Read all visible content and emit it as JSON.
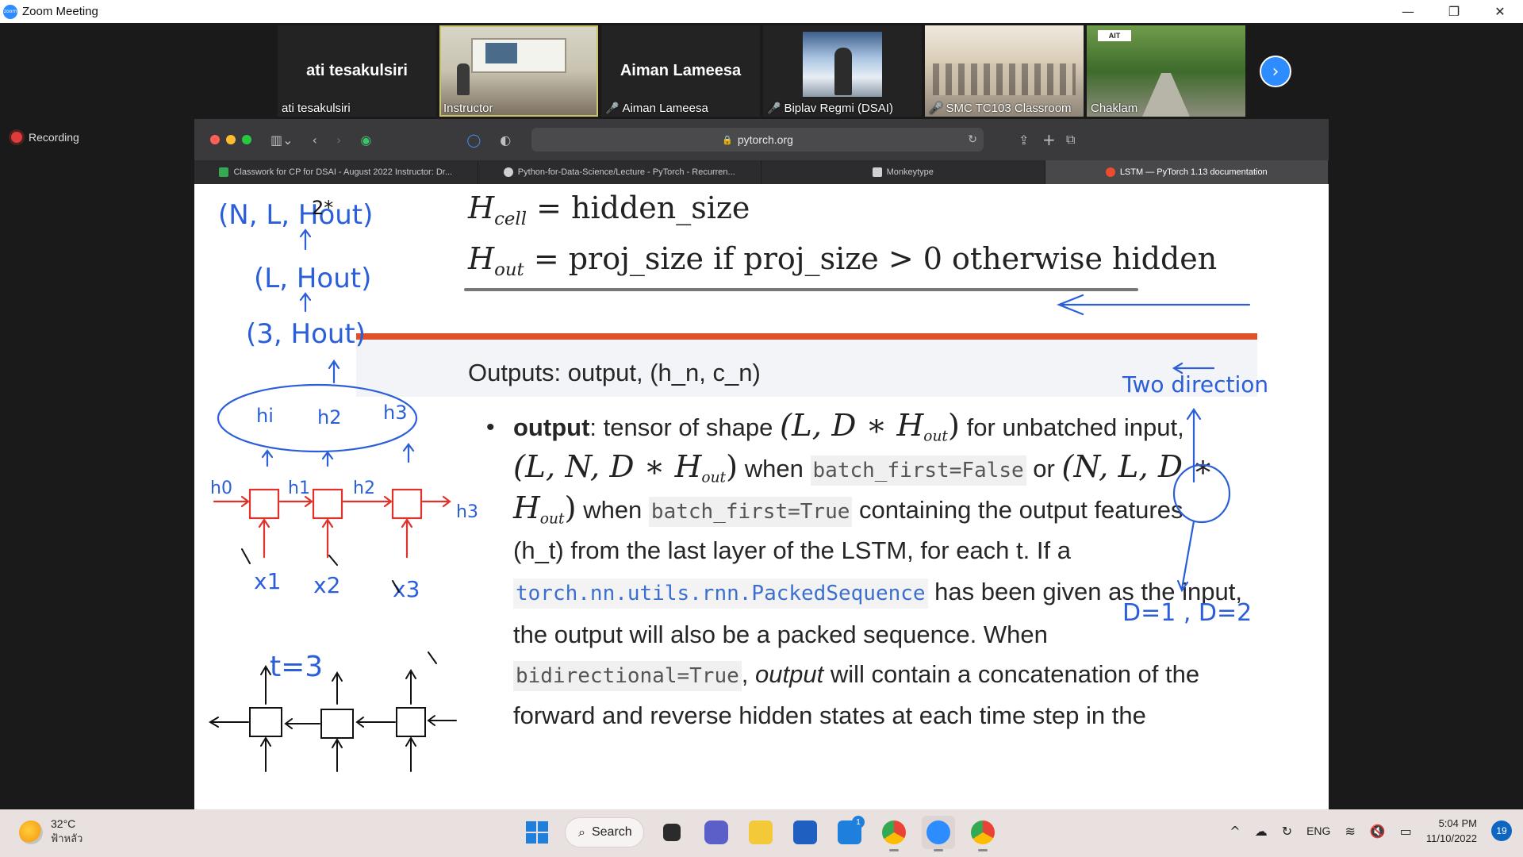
{
  "window": {
    "title": "Zoom Meeting",
    "controls": {
      "minimize": "—",
      "restore": "❐",
      "close": "✕"
    }
  },
  "participants": [
    {
      "big_name": "ati tesakulsiri",
      "name": "ati tesakulsiri",
      "muted": false
    },
    {
      "big_name": "",
      "name": "Instructor",
      "muted": false
    },
    {
      "big_name": "Aiman Lameesa",
      "name": "Aiman Lameesa",
      "muted": true
    },
    {
      "big_name": "",
      "name": "Biplav Regmi (DSAI)",
      "muted": true
    },
    {
      "big_name": "",
      "name": "SMC TC103 Classroom",
      "muted": true
    },
    {
      "big_name": "",
      "name": "Chaklam",
      "muted": false
    }
  ],
  "recording_label": "Recording",
  "tile_logo_text": "AIT",
  "browser": {
    "url": "pytorch.org",
    "tabs": [
      {
        "title": "Classwork for CP for DSAI - August 2022 Instructor: Dr...",
        "color": "#34a853"
      },
      {
        "title": "Python-for-Data-Science/Lecture - PyTorch - Recurren...",
        "color": "#d0d0d0"
      },
      {
        "title": "Monkeytype",
        "color": "#d0d0d0"
      },
      {
        "title": "LSTM — PyTorch 1.13 documentation",
        "color": "#ee4c2c"
      }
    ]
  },
  "doc": {
    "eq1_var": "H",
    "eq1_sub": "cell",
    "eq1_rhs": "= hidden_size",
    "eq2_var": "H",
    "eq2_sub": "out",
    "eq2_rhs": "= proj_size if proj_size > 0 otherwise hidden",
    "outputs_title": "Outputs: output, (h_n, c_n)",
    "bullet": "•",
    "p1_bold": "output",
    "p1_text": ": tensor of shape ",
    "p1_tail": " for unbatched input,",
    "shape_unbatched": "(L, D ∗ H",
    "shape_batched_false": "(L, N, D ∗ H",
    "when1": " when ",
    "code_bf_false": "batch_first=False",
    "or": " or ",
    "shape_batched_true_a": "(N, L, D ∗",
    "shape_batched_true_b": "H",
    "when2": " when ",
    "code_bf_true": "batch_first=True",
    "p3_tail": " containing the output features",
    "p4": "(h_t) from the last layer of the LSTM, for each t. If a",
    "code_packed": "torch.nn.utils.rnn.PackedSequence",
    "p5_tail": " has been given as the input,",
    "p6": "the output will also be a packed sequence. When",
    "code_bidir": "bidirectional=True",
    "p7_mid": ", ",
    "p7_italic": "output",
    "p7_tail": " will contain a concatenation of the",
    "p8": "forward and reverse hidden states at each time step in the",
    "sub_out": "out"
  },
  "ink": {
    "shape_top": "(N, L, Hout)",
    "two_star": "2*",
    "shape_mid": "(L, Hout)",
    "shape_low": "(3, Hout)",
    "h_labels": [
      "hi",
      "h2",
      "h3"
    ],
    "h0": "h0",
    "h1": "h1",
    "h2r": "h2",
    "h3r": "h3",
    "x_labels": [
      "x1",
      "x2",
      "x3"
    ],
    "t3": "t=3",
    "two_direction": "Two direction",
    "d_values": "D=1 , D=2"
  },
  "taskbar": {
    "temperature": "32°C",
    "weather_desc": "ฟ้าหลัว",
    "search_label": "Search",
    "lang": "ENG",
    "time": "5:04 PM",
    "date": "11/10/2022",
    "notification_count": "19",
    "mail_badge": "1"
  }
}
